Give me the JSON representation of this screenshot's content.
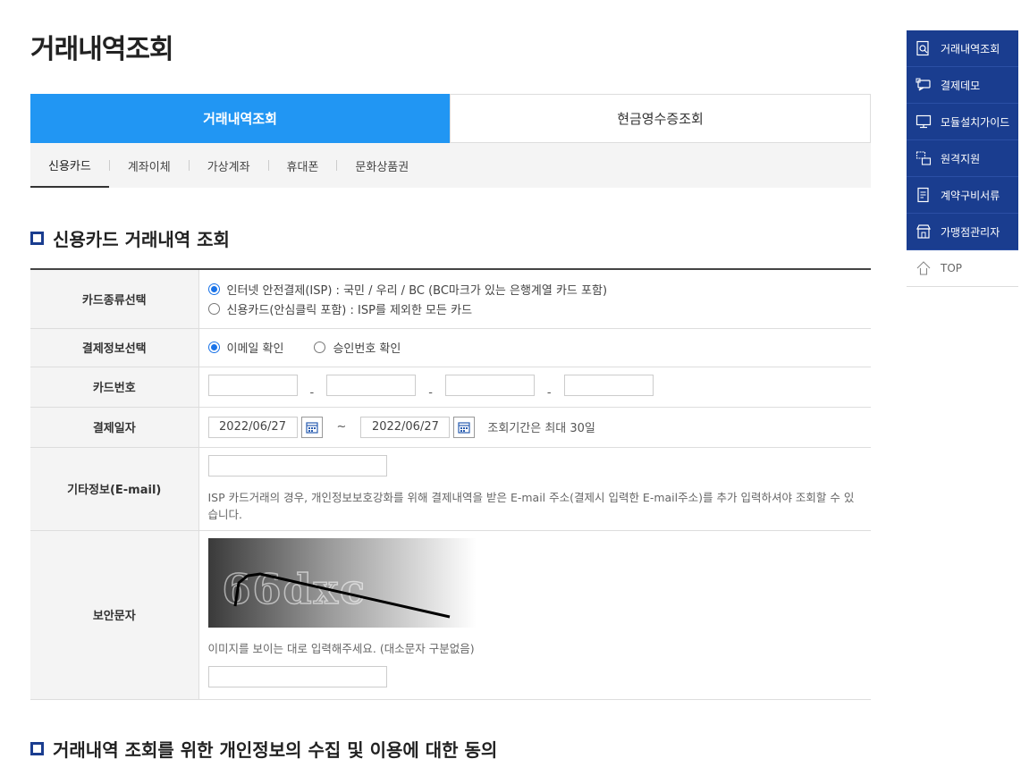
{
  "page_title": "거래내역조회",
  "main_tabs": [
    {
      "label": "거래내역조회",
      "active": true
    },
    {
      "label": "현금영수증조회",
      "active": false
    }
  ],
  "sub_tabs": [
    "신용카드",
    "계좌이체",
    "가상계좌",
    "휴대폰",
    "문화상품권"
  ],
  "section1_title": "신용카드 거래내역 조회",
  "form": {
    "card_type": {
      "label": "카드종류선택",
      "options": [
        "인터넷 안전결제(ISP) : 국민 / 우리 / BC (BC마크가 있는 은행계열 카드 포함)",
        "신용카드(안심클릭 포함) : ISP를 제외한 모든 카드"
      ],
      "selected": 0
    },
    "pay_info": {
      "label": "결제정보선택",
      "options": [
        "이메일 확인",
        "승인번호 확인"
      ],
      "selected": 0
    },
    "card_number": {
      "label": "카드번호",
      "separator": "-"
    },
    "pay_date": {
      "label": "결제일자",
      "from": "2022/06/27",
      "to": "2022/06/27",
      "tilde": "~",
      "note": "조회기간은 최대 30일"
    },
    "etc_email": {
      "label": "기타정보(E-mail)",
      "help": "ISP 카드거래의 경우, 개인정보보호강화를 위해 결제내역을 받은 E-mail 주소(결제시 입력한 E-mail주소)를 추가 입력하셔야 조회할 수 있습니다."
    },
    "captcha": {
      "label": "보안문자",
      "image_text": "66dxc",
      "help": "이미지를 보이는 대로 입력해주세요. (대소문자 구분없음)"
    }
  },
  "section2_title": "거래내역 조회를 위한 개인정보의 수집 및 이용에 대한 동의",
  "side_menu": {
    "items": [
      {
        "label": "거래내역조회",
        "icon": "search-doc-icon"
      },
      {
        "label": "결제데모",
        "icon": "chat-icon"
      },
      {
        "label": "모듈설치가이드",
        "icon": "monitor-icon"
      },
      {
        "label": "원격지원",
        "icon": "remote-icon"
      },
      {
        "label": "계약구비서류",
        "icon": "document-icon"
      },
      {
        "label": "가맹점관리자",
        "icon": "store-icon"
      }
    ],
    "top_label": "TOP"
  },
  "colors": {
    "tab_active": "#2196f3",
    "side_bg": "#1a3d8f",
    "radio": "#1a73e8"
  }
}
